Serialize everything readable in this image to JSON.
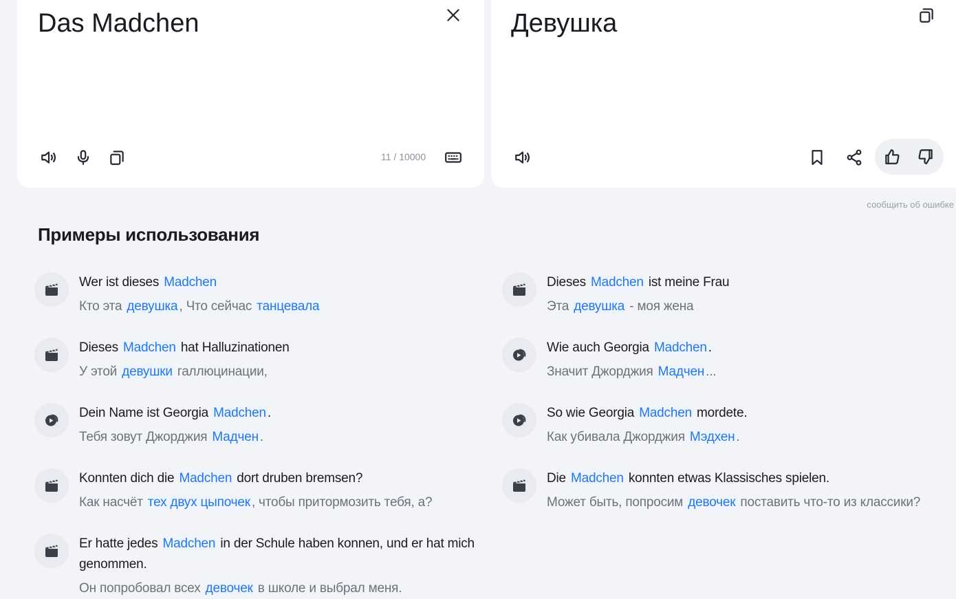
{
  "source": {
    "text": "Das Madchen",
    "counter": "11 / 10000",
    "icons": {
      "clear": "close-icon",
      "speak": "speaker-icon",
      "mic": "microphone-icon",
      "copy": "copy-icon",
      "keyboard": "keyboard-icon"
    }
  },
  "translation": {
    "text": "Девушка",
    "icons": {
      "copy": "copy-icon",
      "speak": "speaker-icon",
      "bookmark": "bookmark-icon",
      "share": "share-icon",
      "like": "thumbs-up-icon",
      "dislike": "thumbs-down-icon"
    }
  },
  "report_error": "сообщить об ошибке",
  "examples_title": "Примеры использования",
  "examples_left": [
    {
      "icon": "clapperboard-icon",
      "src": {
        "pre": "Wer ist dieses ",
        "hl": "Madchen",
        "post": ""
      },
      "dst": {
        "pre": "Кто эта ",
        "hl": "девушка",
        "mid": ", Что сейчас ",
        "hl2": "танцевала",
        "post": ""
      }
    },
    {
      "icon": "clapperboard-icon",
      "src": {
        "pre": "Dieses ",
        "hl": "Madchen",
        "post": " hat Halluzinationen"
      },
      "dst": {
        "pre": "У этой ",
        "hl": "девушки",
        "post": " галлюцинации,"
      }
    },
    {
      "icon": "tv-show-icon",
      "src": {
        "pre": "Dein Name ist Georgia ",
        "hl": "Madchen",
        "post": "."
      },
      "dst": {
        "pre": "Тебя зовут Джорджия ",
        "hl": "Мадчен",
        "post": "."
      }
    },
    {
      "icon": "clapperboard-icon",
      "src": {
        "pre": "Konnten dich die ",
        "hl": "Madchen",
        "post": " dort druben bremsen?"
      },
      "dst": {
        "pre": "Как насчёт ",
        "hl": "тех двух цыпочек",
        "post": ", чтобы притормозить тебя, а?"
      }
    },
    {
      "icon": "clapperboard-icon",
      "src": {
        "pre": "Er hatte jedes ",
        "hl": "Madchen",
        "post": " in der Schule haben konnen, und er hat mich genommen."
      },
      "dst": {
        "pre": "Он попробовал всех ",
        "hl": "девочек",
        "post": " в школе и выбрал меня."
      }
    }
  ],
  "examples_right": [
    {
      "icon": "clapperboard-icon",
      "src": {
        "pre": "Dieses ",
        "hl": "Madchen",
        "post": " ist meine Frau"
      },
      "dst": {
        "pre": "Эта ",
        "hl": "девушка",
        "post": " - моя жена"
      }
    },
    {
      "icon": "tv-show-icon",
      "src": {
        "pre": "Wie auch Georgia ",
        "hl": "Madchen",
        "post": "."
      },
      "dst": {
        "pre": "Значит Джорджия ",
        "hl": "Мадчен",
        "post": "..."
      }
    },
    {
      "icon": "tv-show-icon",
      "src": {
        "pre": "So wie Georgia ",
        "hl": "Madchen",
        "post": " mordete."
      },
      "dst": {
        "pre": "Как убивала Джорджия ",
        "hl": "Мэдхен",
        "post": "."
      }
    },
    {
      "icon": "clapperboard-icon",
      "src": {
        "pre": "Die ",
        "hl": "Madchen",
        "post": " konnten etwas Klassisches spielen."
      },
      "dst": {
        "pre": "Может быть, попросим ",
        "hl": "девочек",
        "post": " поставить что-то из классики?"
      }
    }
  ]
}
